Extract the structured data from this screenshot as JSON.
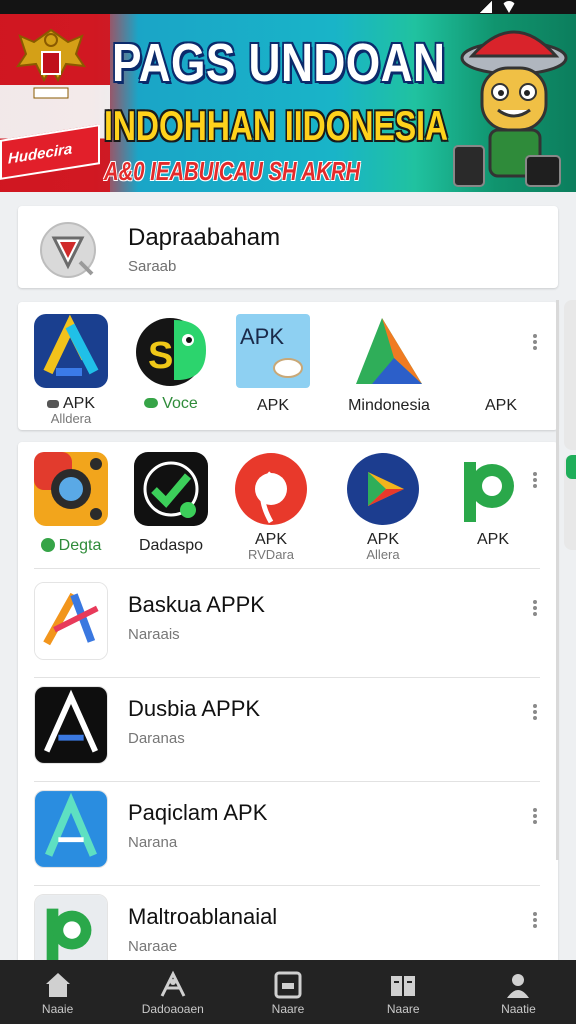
{
  "banner": {
    "title_line1": "PAGS UNDOAN",
    "title_line2": "INDOHHAN IIDONESIA",
    "title_line3": "A&0 IEABUICAU SH AKRH",
    "ribbon": "Hudecira"
  },
  "top_card": {
    "title": "Dapraabaham",
    "subtitle": "Saraab",
    "icon": "shield-v-icon"
  },
  "grid_row_1": {
    "items": [
      {
        "label": "APK",
        "sub": "Alldera",
        "icon": "app-a-blue-icon",
        "badge_icon": "controller-icon"
      },
      {
        "label": "Voce",
        "sub": "",
        "icon": "app-s-green-icon",
        "badge_icon": "green-leaf-icon"
      },
      {
        "label": "APK",
        "sub": "",
        "icon": "apk-file-icon"
      },
      {
        "label": "Mindonesia",
        "sub": "",
        "icon": "app-triangle-icon"
      },
      {
        "label": "APK",
        "sub": "",
        "icon": "none"
      }
    ]
  },
  "grid_row_2": {
    "items": [
      {
        "label": "Degta",
        "sub": "",
        "icon": "app-camera-icon",
        "badge_icon": "green-play-icon"
      },
      {
        "label": "Dadaspo",
        "sub": "",
        "icon": "app-check-icon"
      },
      {
        "label": "APK",
        "sub": "RVDara",
        "icon": "app-red-circle-icon"
      },
      {
        "label": "APK",
        "sub": "Allera",
        "icon": "app-play-ball-icon"
      },
      {
        "label": "APK",
        "sub": "",
        "icon": "app-p-green-icon"
      }
    ]
  },
  "list": [
    {
      "title": "Baskua APPK",
      "sub": "Naraais",
      "icon": "app-colorful-a-icon"
    },
    {
      "title": "Dusbia APPK",
      "sub": "Daranas",
      "icon": "app-dark-a-icon"
    },
    {
      "title": "Paqiclam APK",
      "sub": "Narana",
      "icon": "app-blue-a-icon"
    },
    {
      "title": "Maltroablanaial",
      "sub": "Naraae",
      "icon": "app-p-green-icon"
    }
  ],
  "nav": [
    {
      "label": "Naaie",
      "icon": "home-icon"
    },
    {
      "label": "Dadoaoaen",
      "icon": "tools-icon"
    },
    {
      "label": "Naare",
      "icon": "media-icon"
    },
    {
      "label": "Naare",
      "icon": "book-icon"
    },
    {
      "label": "Naatie",
      "icon": "person-icon"
    }
  ],
  "colors": {
    "accent_green": "#1fae5a",
    "banner_red": "#d01721",
    "banner_teal": "#19b4c8",
    "navbar": "#232323"
  }
}
